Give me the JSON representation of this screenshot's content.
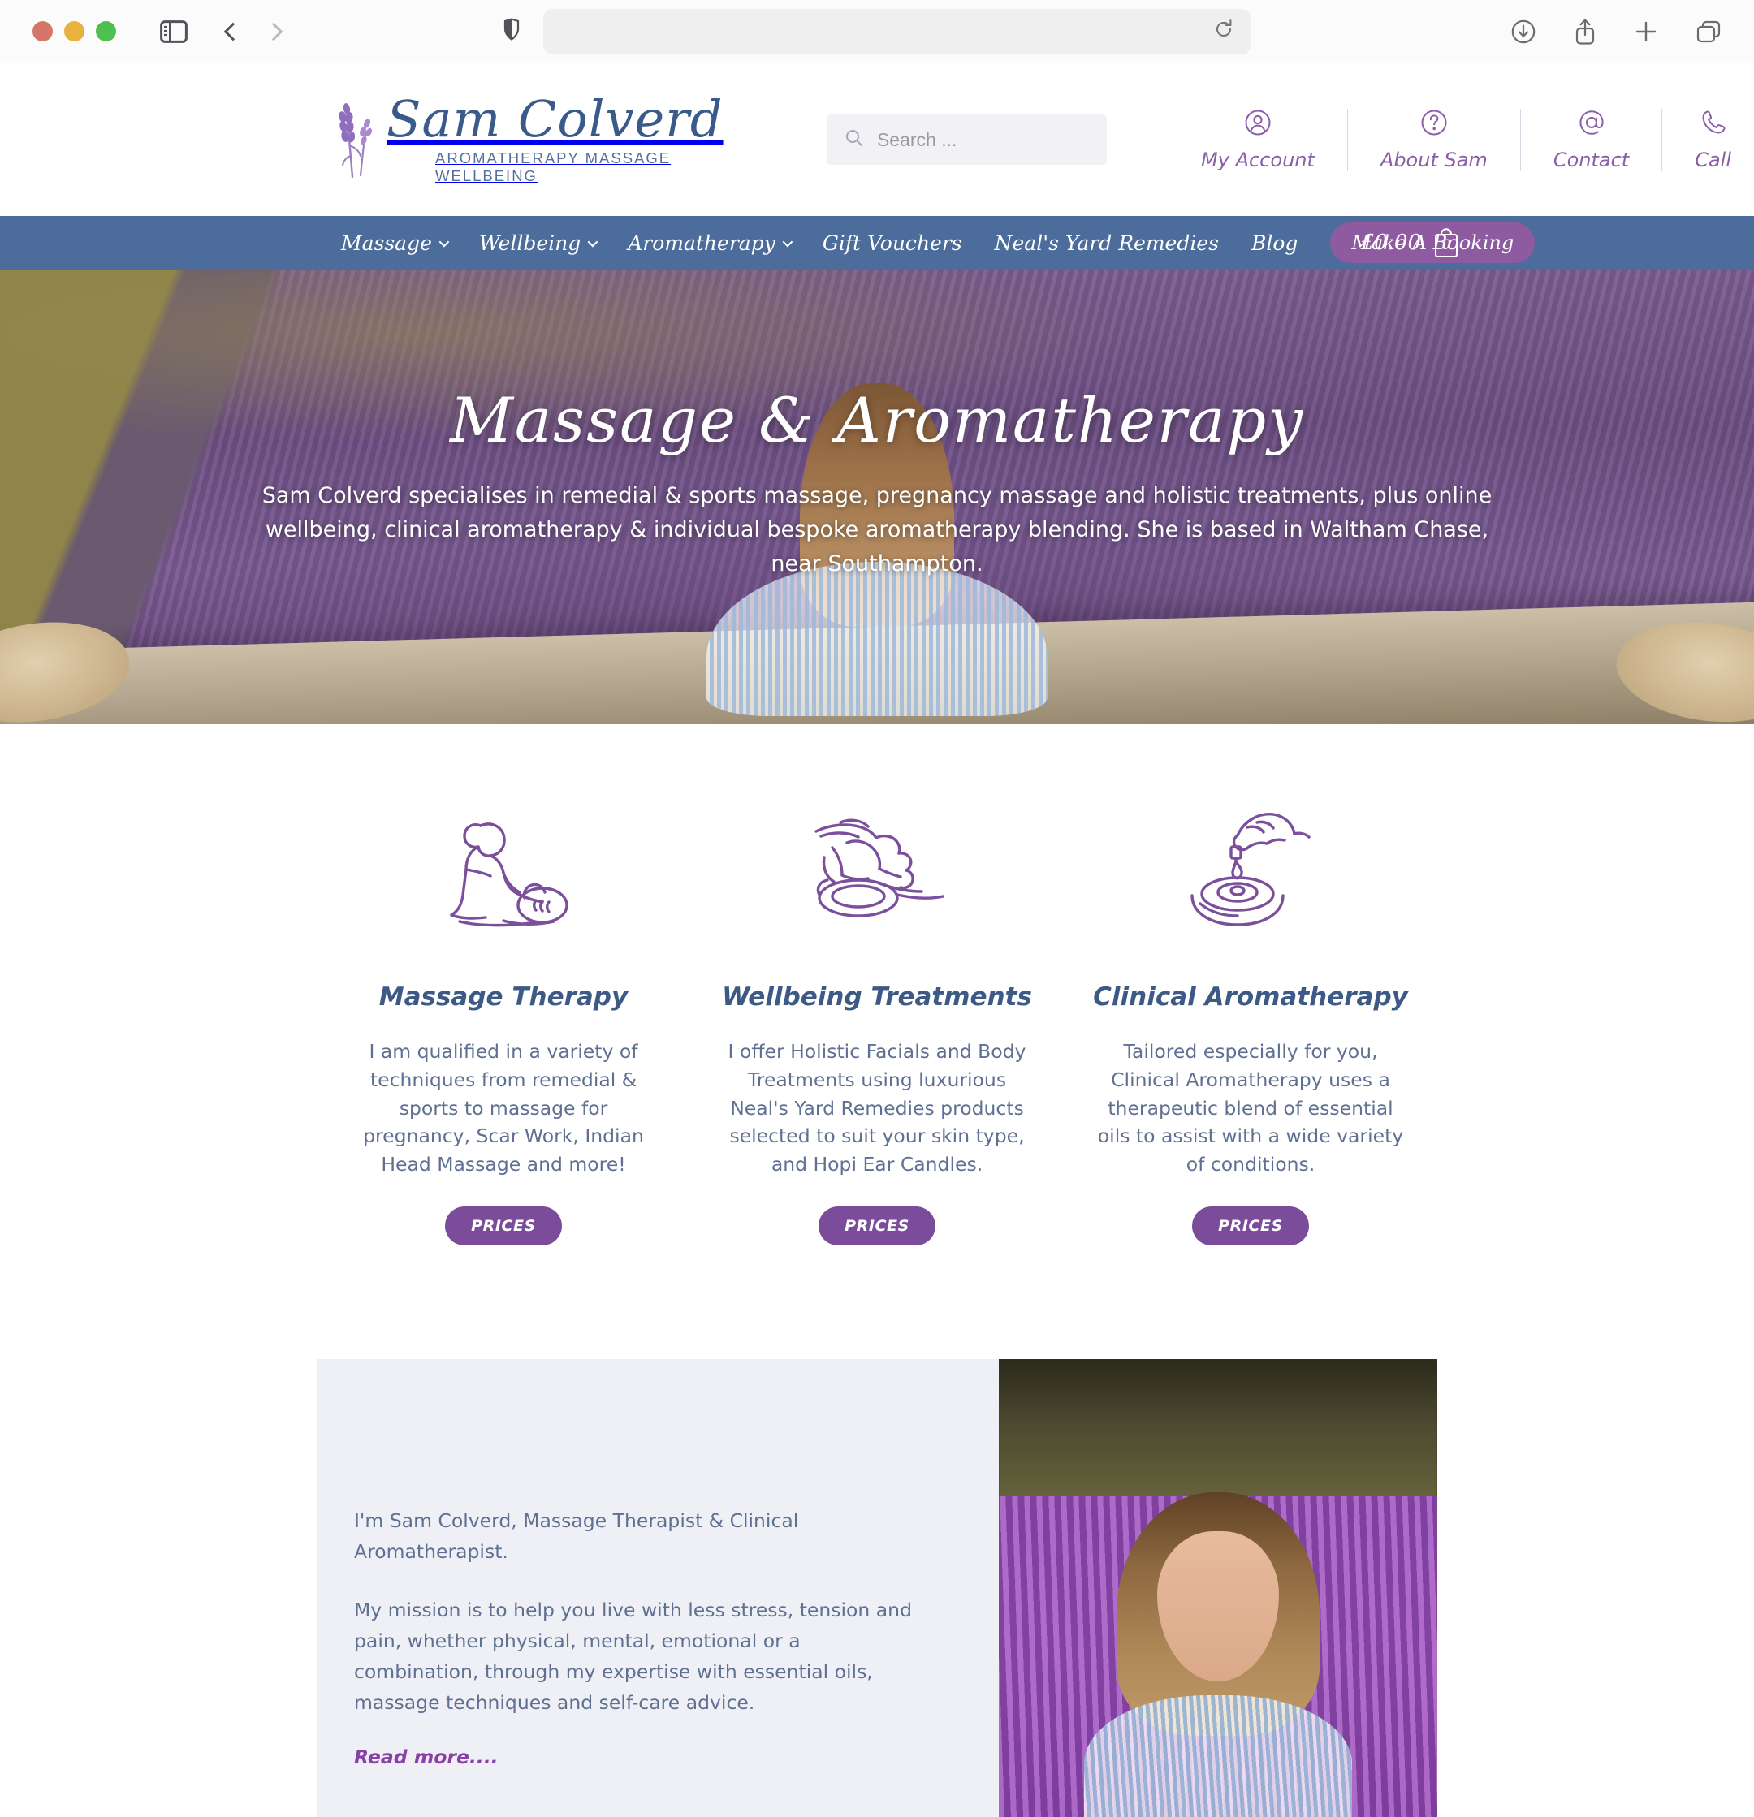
{
  "browser": {
    "url_value": "",
    "url_placeholder": "",
    "traffic_lights": [
      "close",
      "minimize",
      "zoom"
    ],
    "toolbar_icons": [
      "sidebar-icon",
      "back-icon",
      "forward-icon",
      "shield-icon",
      "reload-icon",
      "downloads-icon",
      "share-icon",
      "new-tab-icon",
      "tab-overview-icon"
    ]
  },
  "site_header": {
    "logo_name": "Sam Colverd",
    "logo_tagline": "AROMATHERAPY MASSAGE WELLBEING",
    "search": {
      "value": "",
      "placeholder": "Search ..."
    },
    "links": [
      {
        "label": "My Account",
        "icon": "user-circle-icon"
      },
      {
        "label": "About Sam",
        "icon": "question-circle-icon"
      },
      {
        "label": "Contact",
        "icon": "at-sign-icon"
      },
      {
        "label": "Call",
        "icon": "phone-icon"
      }
    ]
  },
  "nav": {
    "items": [
      {
        "label": "Massage",
        "has_dropdown": true
      },
      {
        "label": "Wellbeing",
        "has_dropdown": true
      },
      {
        "label": "Aromatherapy",
        "has_dropdown": true
      },
      {
        "label": "Gift Vouchers",
        "has_dropdown": false
      },
      {
        "label": "Neal's Yard Remedies",
        "has_dropdown": false
      },
      {
        "label": "Blog",
        "has_dropdown": false
      }
    ],
    "booking_label": "Make A Booking",
    "cart_total": "£0.00",
    "cart_count": "0",
    "bar_color": "#4c6d9b",
    "booking_color": "#8e5ba0"
  },
  "hero": {
    "title": "Massage & Aromatherapy",
    "subtitle": "Sam Colverd specialises in remedial & sports massage, pregnancy massage and holistic treatments, plus online wellbeing, clinical aromatherapy & individual bespoke aromatherapy blending. She is based in Waltham Chase, near Southampton."
  },
  "services": {
    "cards": [
      {
        "icon": "massage-therapist-icon",
        "title": "Massage Therapy",
        "body": "I am qualified in a variety of techniques from remedial & sports to massage for pregnancy,  Scar Work, Indian Head Massage and more!",
        "button": "PRICES"
      },
      {
        "icon": "facial-treatment-icon",
        "title": "Wellbeing Treatments",
        "body": "I offer Holistic Facials and Body Treatments using luxurious Neal's Yard Remedies products selected to suit your skin type, and Hopi Ear Candles.",
        "button": "PRICES"
      },
      {
        "icon": "oil-drop-bowl-icon",
        "title": "Clinical Aromatherapy",
        "body": "Tailored especially for you, Clinical Aromatherapy uses a therapeutic blend of essential oils to assist with a wide variety of conditions.",
        "button": "PRICES"
      }
    ],
    "title_color": "#3d5a87",
    "body_color": "#5f7093",
    "button_color": "#7a4c99"
  },
  "about": {
    "line1": "I'm Sam Colverd, Massage Therapist & Clinical Aromatherapist.",
    "line2": "My mission is to help you live with less stress, tension and pain, whether physical, mental, emotional or a combination, through my expertise with essential oils, massage techniques and self-care advice.",
    "read_more": "Read more....",
    "panel_color": "#eff0f5",
    "photo_alt": "Sam Colverd portrait in a lavender field"
  }
}
